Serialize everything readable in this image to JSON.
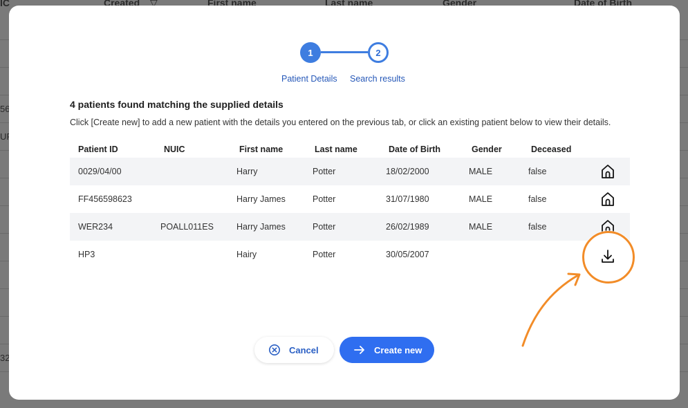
{
  "background": {
    "header_columns": [
      "IC",
      "Created",
      "First name",
      "Last name",
      "Gender",
      "Date of Birth"
    ],
    "sort_indicator": "▽",
    "left_fragments": [
      "56",
      "UF",
      "32"
    ]
  },
  "stepper": {
    "steps": [
      {
        "number": "1",
        "label": "Patient Details"
      },
      {
        "number": "2",
        "label": "Search results"
      }
    ]
  },
  "results": {
    "title": "4 patients found matching the supplied details",
    "description": "Click [Create new] to add a new patient with the details you entered on the previous tab, or click an existing patient below to view their details."
  },
  "table": {
    "columns": [
      "Patient ID",
      "NUIC",
      "First name",
      "Last name",
      "Date of Birth",
      "Gender",
      "Deceased"
    ],
    "rows": [
      {
        "patient_id": "0029/04/00",
        "nuic": "",
        "first_name": "Harry",
        "last_name": "Potter",
        "dob": "18/02/2000",
        "gender": "MALE",
        "deceased": "false",
        "action_icon": "home-icon"
      },
      {
        "patient_id": "FF456598623",
        "nuic": "",
        "first_name": "Harry James",
        "last_name": "Potter",
        "dob": "31/07/1980",
        "gender": "MALE",
        "deceased": "false",
        "action_icon": "home-icon"
      },
      {
        "patient_id": "WER234",
        "nuic": "POALL011ES",
        "first_name": "Harry James",
        "last_name": "Potter",
        "dob": "26/02/1989",
        "gender": "MALE",
        "deceased": "false",
        "action_icon": "home-icon"
      },
      {
        "patient_id": "HP3",
        "nuic": "",
        "first_name": "Hairy",
        "last_name": "Potter",
        "dob": "30/05/2007",
        "gender": "",
        "deceased": "",
        "action_icon": "download-icon"
      }
    ]
  },
  "buttons": {
    "cancel_label": "Cancel",
    "create_label": "Create new"
  },
  "colors": {
    "primary": "#2f6ef0",
    "step_blue": "#3e7de0",
    "annotation_orange": "#f28c28"
  }
}
